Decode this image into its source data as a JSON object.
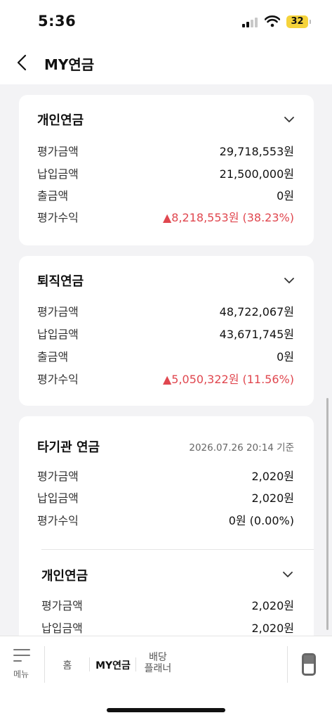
{
  "status_bar": {
    "time": "5:36",
    "battery": "32"
  },
  "header": {
    "title": "MY연금"
  },
  "cards": {
    "personal": {
      "title": "개인연금",
      "rows": [
        {
          "label": "평가금액",
          "value": "29,718,553원"
        },
        {
          "label": "납입금액",
          "value": "21,500,000원"
        },
        {
          "label": "출금액",
          "value": "0원"
        },
        {
          "label": "평가수익",
          "value": "▲8,218,553원 (38.23%)"
        }
      ]
    },
    "retirement": {
      "title": "퇴직연금",
      "rows": [
        {
          "label": "평가금액",
          "value": "48,722,067원"
        },
        {
          "label": "납입금액",
          "value": "43,671,745원"
        },
        {
          "label": "출금액",
          "value": "0원"
        },
        {
          "label": "평가수익",
          "value": "▲5,050,322원 (11.56%)"
        }
      ]
    },
    "other": {
      "title": "타기관 연금",
      "date": "2026.07.26 20:14 기준",
      "rows": [
        {
          "label": "평가금액",
          "value": "2,020원"
        },
        {
          "label": "납입금액",
          "value": "2,020원"
        },
        {
          "label": "평가수익",
          "value": "0원 (0.00%)"
        }
      ],
      "sub": {
        "title": "개인연금",
        "rows": [
          {
            "label": "평가금액",
            "value": "2,020원"
          },
          {
            "label": "납입금액",
            "value": "2,020원"
          }
        ]
      }
    }
  },
  "tabbar": {
    "menu_label": "메뉴",
    "home": "홈",
    "my_pension": "MY연금",
    "dividend_line1": "배당",
    "dividend_line2": "플래너"
  },
  "colors": {
    "profit": "#e0474f",
    "battery": "#f5d33b"
  },
  "icons": [
    "signal-icon",
    "wifi-icon",
    "battery-icon",
    "back-arrow-icon",
    "chevron-down-icon",
    "menu-icon",
    "phone-icon"
  ]
}
